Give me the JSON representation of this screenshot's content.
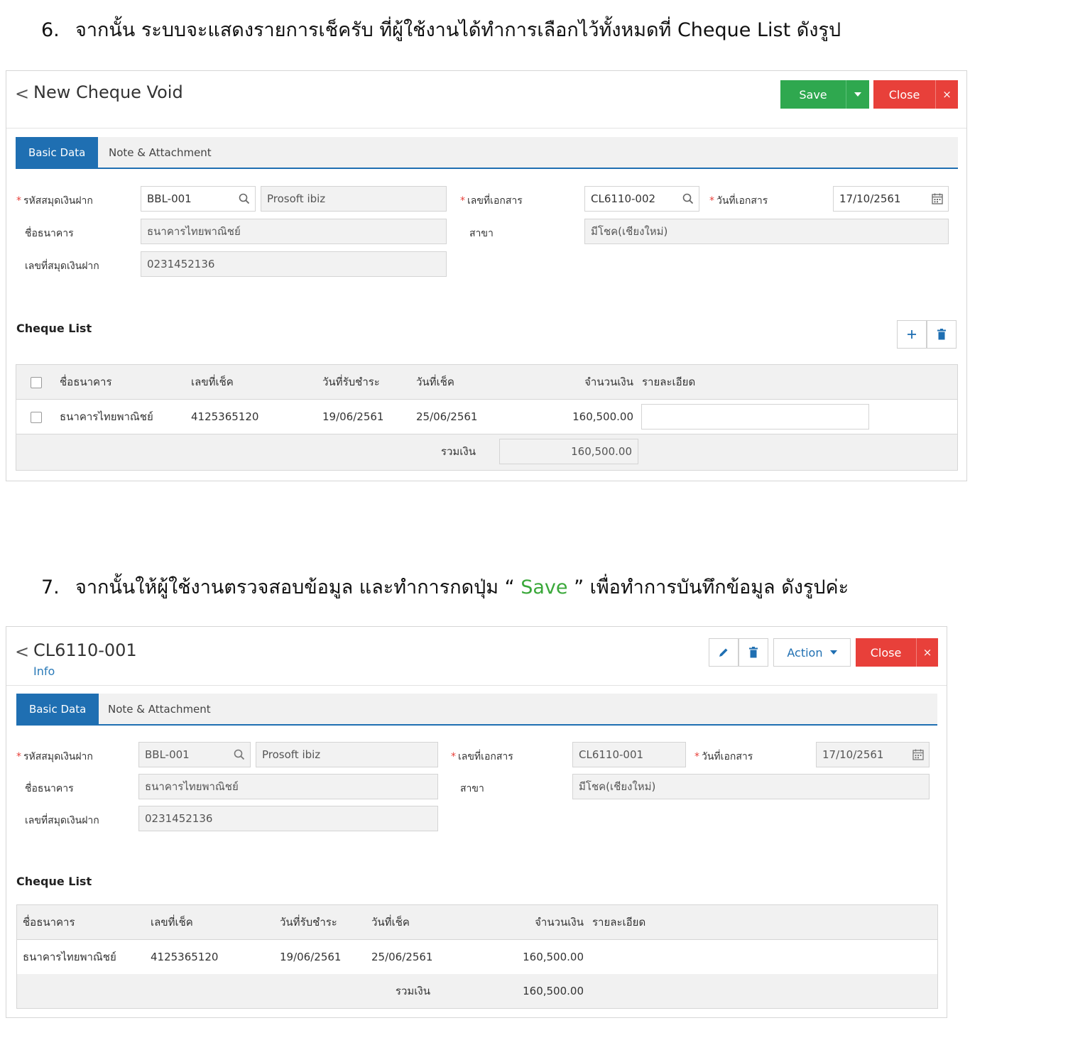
{
  "step6": {
    "num": "6.",
    "text": "จากนั้น ระบบจะแสดงรายการเช็ครับ ที่ผู้ใช้งานได้ทำการเลือกไว้ทั้งหมดที่ Cheque List ดังรูป"
  },
  "step7": {
    "num": "7.",
    "text_before": "จากนั้นให้ผู้ใช้งานตรวจสอบข้อมูล และทำการกดปุ่ม “ ",
    "save_word": "Save",
    "text_after": " ” เพื่อทำการบันทึกข้อมูล ดังรูปค่ะ"
  },
  "colors": {
    "accent": "#1f6fb2",
    "save": "#2fa84f",
    "close": "#e8403a"
  },
  "form1": {
    "back": "<",
    "title": "New Cheque Void",
    "save_label": "Save",
    "close_label": "Close",
    "close_x": "×",
    "tabs": [
      "Basic Data",
      "Note & Attachment"
    ],
    "labels": {
      "book_code": "รหัสสมุดเงินฝาก",
      "bank_name": "ชื่อธนาคาร",
      "book_no": "เลขที่สมุดเงินฝาก",
      "doc_no": "เลขที่เอกสาร",
      "branch": "สาขา",
      "doc_date": "วันที่เอกสาร"
    },
    "values": {
      "book_code": "BBL-001",
      "company": "Prosoft ibiz",
      "bank_name": "ธนาคารไทยพาณิชย์",
      "book_no": "0231452136",
      "doc_no": "CL6110-002",
      "branch": "มีโชค(เชียงใหม่)",
      "doc_date": "17/10/2561"
    },
    "section": "Cheque List",
    "table": {
      "headers": [
        "ชื่อธนาคาร",
        "เลขที่เช็ค",
        "วันที่รับชำระ",
        "วันที่เช็ค",
        "จำนวนเงิน",
        "รายละเอียด"
      ],
      "rows": [
        [
          "ธนาคารไทยพาณิชย์",
          "4125365120",
          "19/06/2561",
          "25/06/2561",
          "160,500.00",
          ""
        ]
      ],
      "total_label": "รวมเงิน",
      "total_value": "160,500.00"
    }
  },
  "form2": {
    "back": "<",
    "title": "CL6110-001",
    "subtitle": "Info",
    "action_label": "Action",
    "close_label": "Close",
    "close_x": "×",
    "tabs": [
      "Basic Data",
      "Note & Attachment"
    ],
    "labels": {
      "book_code": "รหัสสมุดเงินฝาก",
      "bank_name": "ชื่อธนาคาร",
      "book_no": "เลขที่สมุดเงินฝาก",
      "doc_no": "เลขที่เอกสาร",
      "branch": "สาขา",
      "doc_date": "วันที่เอกสาร"
    },
    "values": {
      "book_code": "BBL-001",
      "company": "Prosoft ibiz",
      "bank_name": "ธนาคารไทยพาณิชย์",
      "book_no": "0231452136",
      "doc_no": "CL6110-001",
      "branch": "มีโชค(เชียงใหม่)",
      "doc_date": "17/10/2561"
    },
    "section": "Cheque List",
    "table": {
      "headers": [
        "ชื่อธนาคาร",
        "เลขที่เช็ค",
        "วันที่รับชำระ",
        "วันที่เช็ค",
        "จำนวนเงิน",
        "รายละเอียด"
      ],
      "rows": [
        [
          "ธนาคารไทยพาณิชย์",
          "4125365120",
          "19/06/2561",
          "25/06/2561",
          "160,500.00",
          ""
        ]
      ],
      "total_label": "รวมเงิน",
      "total_value": "160,500.00"
    }
  }
}
